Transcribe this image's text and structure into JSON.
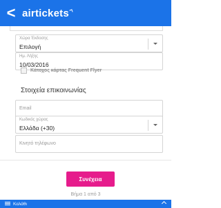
{
  "header": {
    "back_symbol": "<",
    "brand": "airtickets"
  },
  "form": {
    "issue_country": {
      "label": "Χώρα Έκδοσης",
      "value": "Επιλογή"
    },
    "expiry_date": {
      "label": "Ημ. Λήξης",
      "value": "10/03/2016"
    },
    "frequent_flyer": {
      "label": "Κάτοχος κάρτας Frequent Flyer",
      "checked": false
    }
  },
  "contact": {
    "title": "Στοιχεία επικοινωνίας",
    "email": {
      "placeholder": "Email",
      "value": ""
    },
    "country_code": {
      "label": "Κωδικός χώρας",
      "value": "Ελλάδα (+30)"
    },
    "mobile": {
      "placeholder": "Κινητό τηλέφωνο",
      "value": ""
    }
  },
  "footer": {
    "continue_label": "Συνέχεια",
    "step_text": "Βήμα 1 από 3",
    "cart_label": "Καλάθι"
  },
  "colors": {
    "primary": "#1b73e8",
    "accent": "#e61c8c"
  }
}
